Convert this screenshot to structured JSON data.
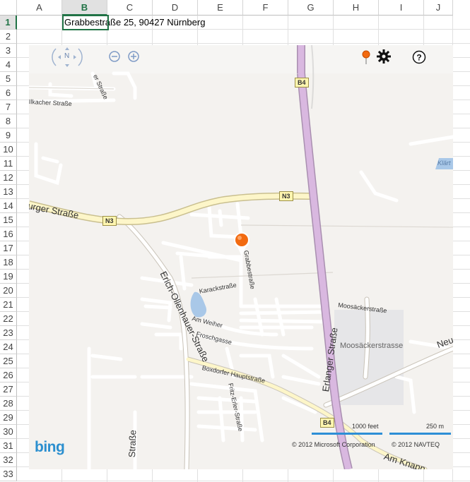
{
  "columns": [
    "A",
    "B",
    "C",
    "D",
    "E",
    "F",
    "G",
    "H",
    "I",
    "J"
  ],
  "selected_column": "B",
  "rows": [
    "1",
    "2",
    "3",
    "4",
    "5",
    "6",
    "7",
    "8",
    "9",
    "10",
    "11",
    "12",
    "13",
    "14",
    "15",
    "16",
    "17",
    "18",
    "19",
    "20",
    "21",
    "22",
    "23",
    "24",
    "25",
    "26",
    "27",
    "28",
    "29",
    "30",
    "31",
    "32",
    "33"
  ],
  "selected_row": "1",
  "cell_b1": "Grabbestraße 25, 90427 Nürnberg",
  "map": {
    "compass_label": "N",
    "brand": "bing",
    "copyright_microsoft": "© 2012 Microsoft Corporation",
    "copyright_navteq": "© 2012 NAVTEQ",
    "scale_feet": "1000 feet",
    "scale_meters": "250 m",
    "shields": {
      "b4_top": "B4",
      "b4_bottom": "B4",
      "n3_right": "N3",
      "n3_left": "N3"
    },
    "labels": {
      "er_strasse": "er Straße",
      "ilkacher": "Ilkacher Straße",
      "klaert": "Klärt",
      "burger": "urger Straße",
      "grabbe": "Grabbestraße",
      "erich": "Erich-Ollenhauer-Straße",
      "karack": "Karackstraße",
      "am_weiher": "Am Weiher",
      "froschgasse": "Froschgasse",
      "boxdorfer": "Boxdorfer Hauptstraße",
      "fritz": "Fritz-Erler-Straße",
      "erlanger": "Erlanger Straße",
      "moosaeckerstr": "Moosäckerstraße",
      "moosaeckerstrasse": "Moosäckerstrasse",
      "neur": "Neur",
      "am_knapp": "Am Knapp",
      "strasse_bottom": "Straße"
    },
    "colors": {
      "pin": "#f26a10",
      "freeway": "#d9b8e0",
      "main_road": "#fdf6c9",
      "water": "#a9c8e8"
    }
  }
}
